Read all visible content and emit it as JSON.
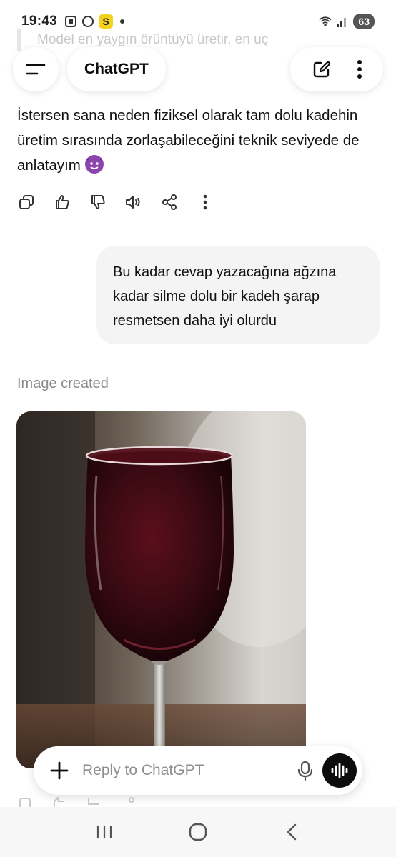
{
  "status_bar": {
    "time": "19:43",
    "battery": "63"
  },
  "faded_previous_text": "Model en yaygın örüntüyü üretir, en uç",
  "header": {
    "title": "ChatGPT"
  },
  "assistant_message": {
    "text": "İstersen sana neden fiziksel olarak tam dolu kadehin üretim sırasında zorlaşabileceğini teknik seviyede de anlatayım",
    "emoji": "smiling-face-with-horns-icon"
  },
  "user_message": {
    "text": "Bu kadar cevap yazacağına ağzına kadar silme dolu bir kadeh şarap resmetsen daha iyi olurdu"
  },
  "image_created_label": "Image created",
  "composer": {
    "placeholder": "Reply to ChatGPT"
  },
  "colors": {
    "accent": "#0d0d0d",
    "bubble": "#f4f4f4",
    "wine": "#3a0a12"
  }
}
